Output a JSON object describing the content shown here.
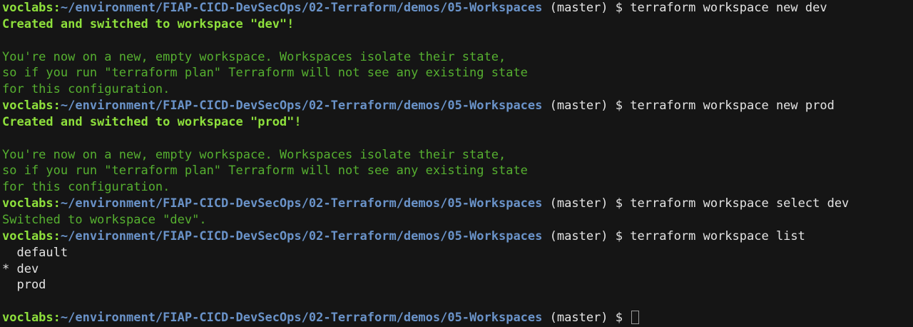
{
  "prompt": {
    "user": "voclabs:",
    "path": "~/environment/FIAP-CICD-DevSecOps/02-Terraform/demos/05-Workspaces",
    "branch": " (master) ",
    "symbol": "$ "
  },
  "lines": [
    {
      "type": "prompt",
      "command": "terraform workspace new dev"
    },
    {
      "type": "success",
      "text": "Created and switched to workspace \"dev\"!"
    },
    {
      "type": "blank",
      "text": ""
    },
    {
      "type": "info",
      "text": "You're now on a new, empty workspace. Workspaces isolate their state,"
    },
    {
      "type": "info",
      "text": "so if you run \"terraform plan\" Terraform will not see any existing state"
    },
    {
      "type": "info",
      "text": "for this configuration."
    },
    {
      "type": "prompt",
      "command": "terraform workspace new prod"
    },
    {
      "type": "success",
      "text": "Created and switched to workspace \"prod\"!"
    },
    {
      "type": "blank",
      "text": ""
    },
    {
      "type": "info",
      "text": "You're now on a new, empty workspace. Workspaces isolate their state,"
    },
    {
      "type": "info",
      "text": "so if you run \"terraform plan\" Terraform will not see any existing state"
    },
    {
      "type": "info",
      "text": "for this configuration."
    },
    {
      "type": "prompt",
      "command": "terraform workspace select dev"
    },
    {
      "type": "info",
      "text": "Switched to workspace \"dev\"."
    },
    {
      "type": "prompt",
      "command": "terraform workspace list"
    },
    {
      "type": "plain",
      "text": "  default"
    },
    {
      "type": "plain",
      "text": "* dev"
    },
    {
      "type": "plain",
      "text": "  prod"
    },
    {
      "type": "blank",
      "text": ""
    },
    {
      "type": "prompt-active",
      "command": ""
    }
  ]
}
